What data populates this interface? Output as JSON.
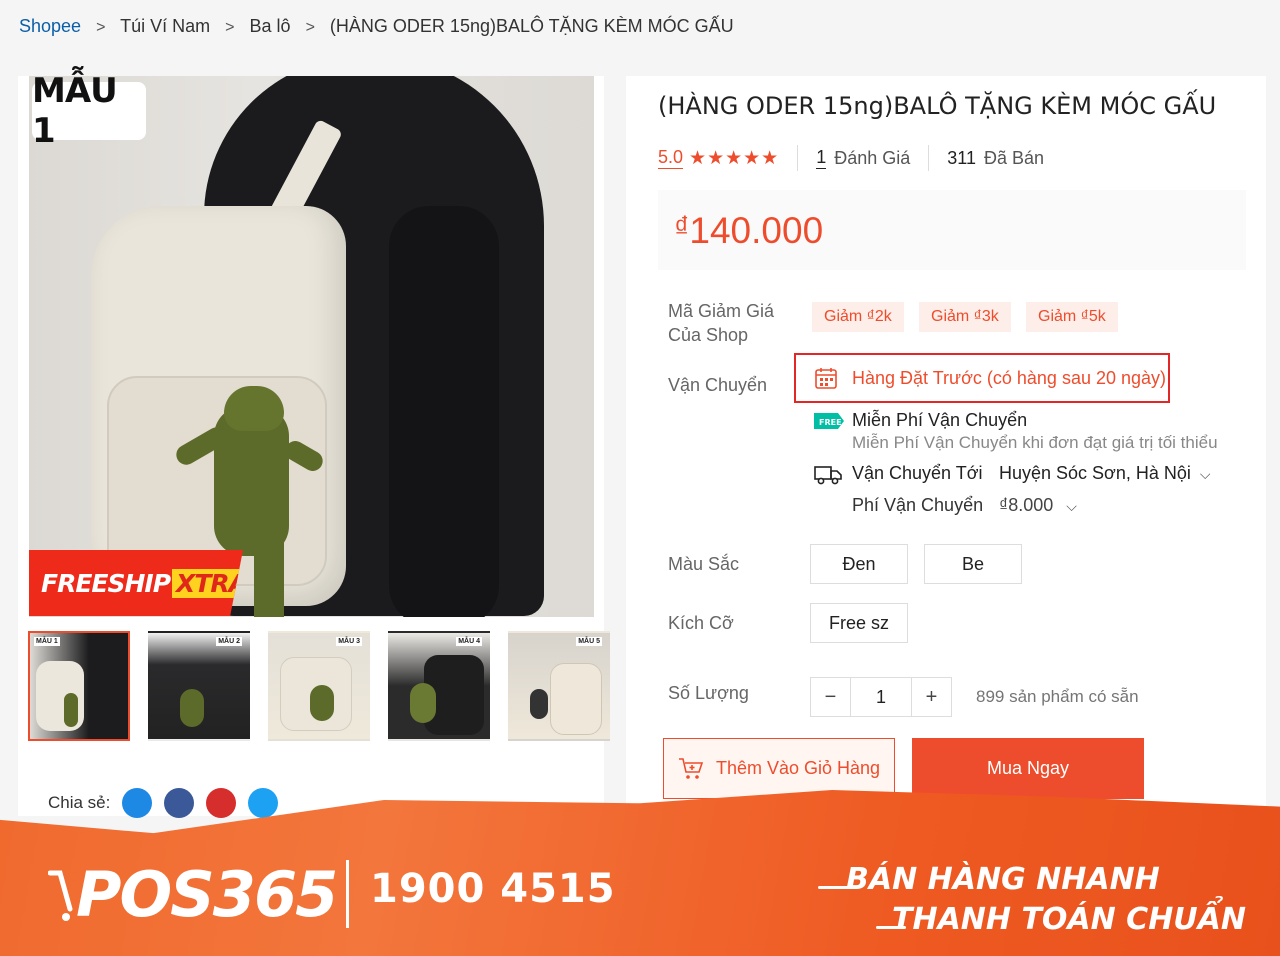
{
  "breadcrumb": {
    "items": [
      "Shopee",
      "Túi Ví Nam",
      "Ba lô",
      "(HÀNG ODER 15ng)BALÔ TẶNG KÈM MÓC GẤU"
    ],
    "separator": ">"
  },
  "gallery": {
    "variant_tag": "MẪU 1",
    "freeship_label": "FREESHIP",
    "freeship_xtra": "XTRA",
    "thumbnails": [
      {
        "label": "MẪU 1",
        "selected": true
      },
      {
        "label": "MẪU 2",
        "selected": false
      },
      {
        "label": "MẪU 3",
        "selected": false
      },
      {
        "label": "MẪU 4",
        "selected": false
      },
      {
        "label": "MẪU 5",
        "selected": false
      }
    ],
    "share_label": "Chia sẻ:"
  },
  "product": {
    "title": "(HÀNG ODER 15ng)BALÔ TẶNG KÈM MÓC GẤU",
    "rating": "5.0",
    "stars": "★★★★★",
    "review_count": "1",
    "review_label": "Đánh Giá",
    "sold_count": "311",
    "sold_label": "Đã Bán",
    "price_currency": "₫",
    "price": "140.000"
  },
  "vouchers": {
    "label_line1": "Mã Giảm Giá",
    "label_line2": "Của Shop",
    "items": [
      "Giảm ₫2k",
      "Giảm ₫3k",
      "Giảm ₫5k"
    ]
  },
  "shipping": {
    "label": "Vận Chuyển",
    "preorder_text": "Hàng Đặt Trước (có hàng sau 20 ngày)",
    "free_badge": "FREE",
    "free_title": "Miễn Phí Vận Chuyển",
    "free_desc": "Miễn Phí Vận Chuyển khi đơn đạt giá trị tối thiểu",
    "to_label": "Vận Chuyển Tới",
    "to_value": "Huyện Sóc Sơn, Hà Nội",
    "fee_label": "Phí Vận Chuyển",
    "fee_value": "₫8.000"
  },
  "options": {
    "color_label": "Màu Sắc",
    "colors": [
      "Đen",
      "Be"
    ],
    "size_label": "Kích Cỡ",
    "sizes": [
      "Free sz"
    ]
  },
  "quantity": {
    "label": "Số Lượng",
    "minus": "−",
    "value": "1",
    "plus": "+",
    "stock": "899 sản phẩm có sẵn"
  },
  "actions": {
    "add_to_cart": "Thêm Vào Giỏ Hàng",
    "buy_now": "Mua Ngay"
  },
  "banner": {
    "logo": "POS365",
    "phone": "1900 4515",
    "slogan_line1": "BÁN HÀNG NHANH",
    "slogan_line2": "THANH TOÁN CHUẨN"
  },
  "colors": {
    "accent": "#ee4d2d",
    "link": "#0b5fa8",
    "highlight_border": "#e32626",
    "banner": "#f06a2e"
  }
}
